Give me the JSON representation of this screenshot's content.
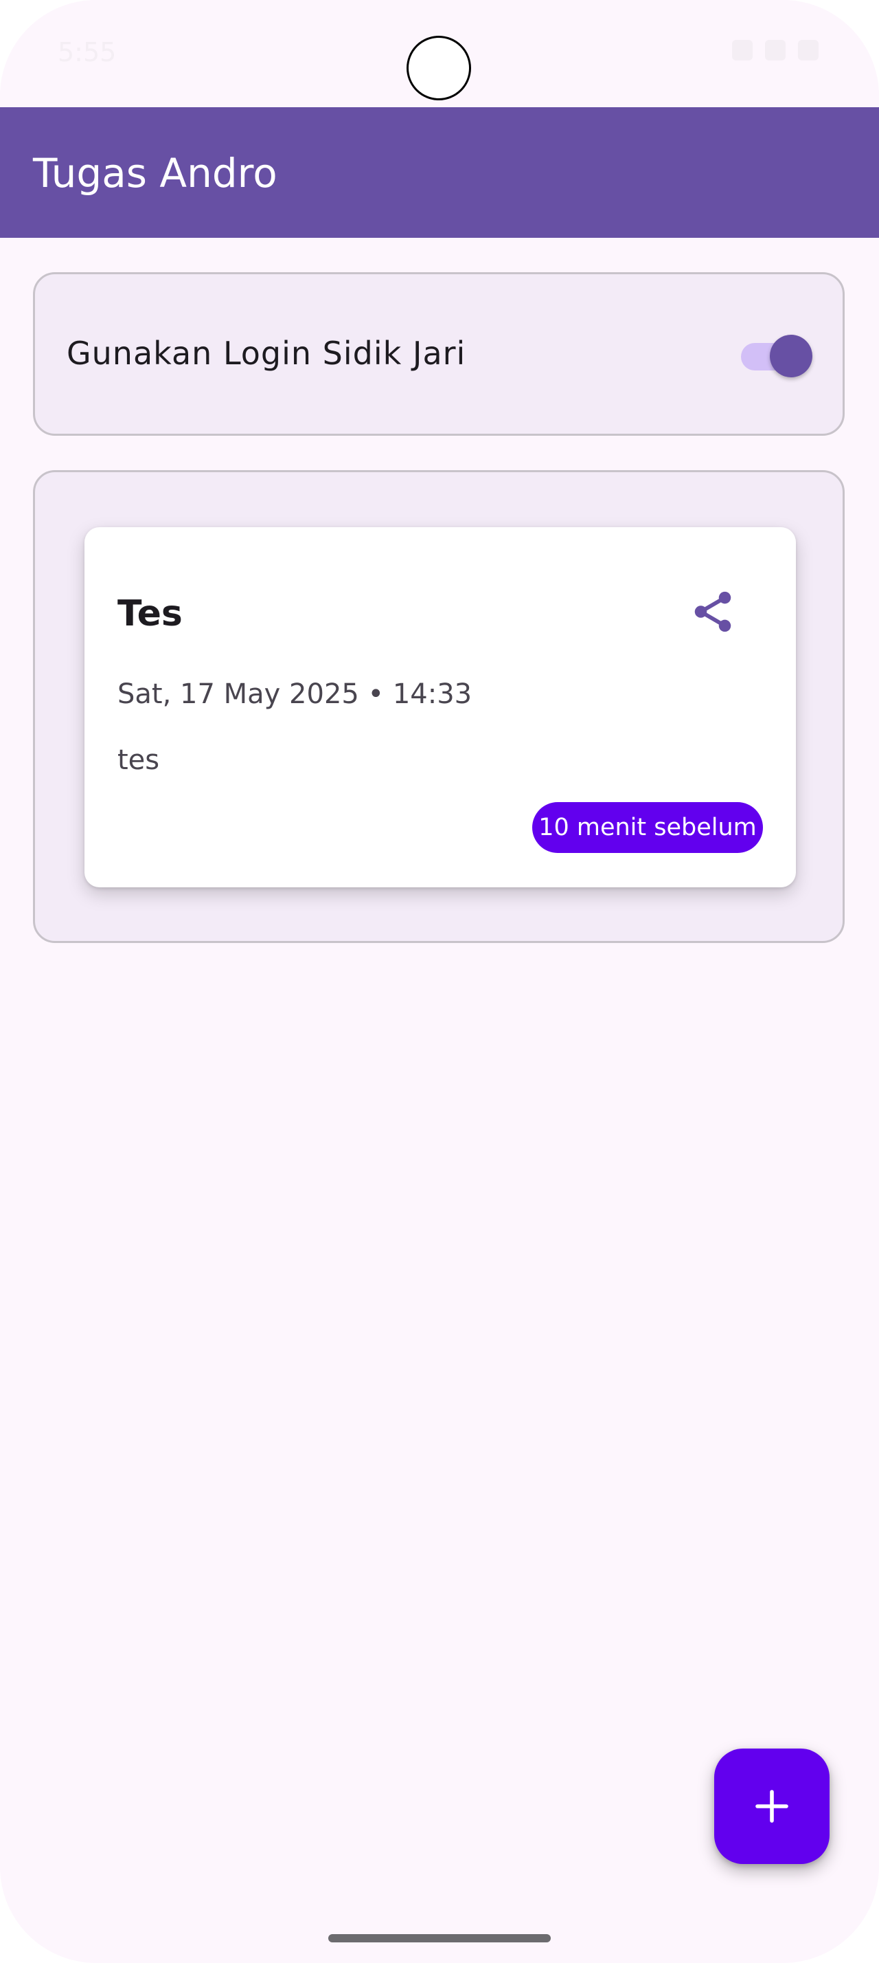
{
  "status_bar": {
    "time": "5:55",
    "icons": [
      "wifi-icon",
      "signal-icon",
      "battery-icon"
    ]
  },
  "app_bar": {
    "title": "Tugas Andro",
    "color": "#6750a4"
  },
  "fingerprint_setting": {
    "label": "Gunakan Login Sidik Jari",
    "enabled": true
  },
  "reminders": [
    {
      "title": "Tes",
      "datetime": "Sat, 17 May 2025 • 14:33",
      "description": "tes",
      "badge": "10 menit sebelum",
      "share_icon": "share-icon"
    }
  ],
  "fab": {
    "icon": "plus-icon",
    "color": "#6200ee"
  }
}
